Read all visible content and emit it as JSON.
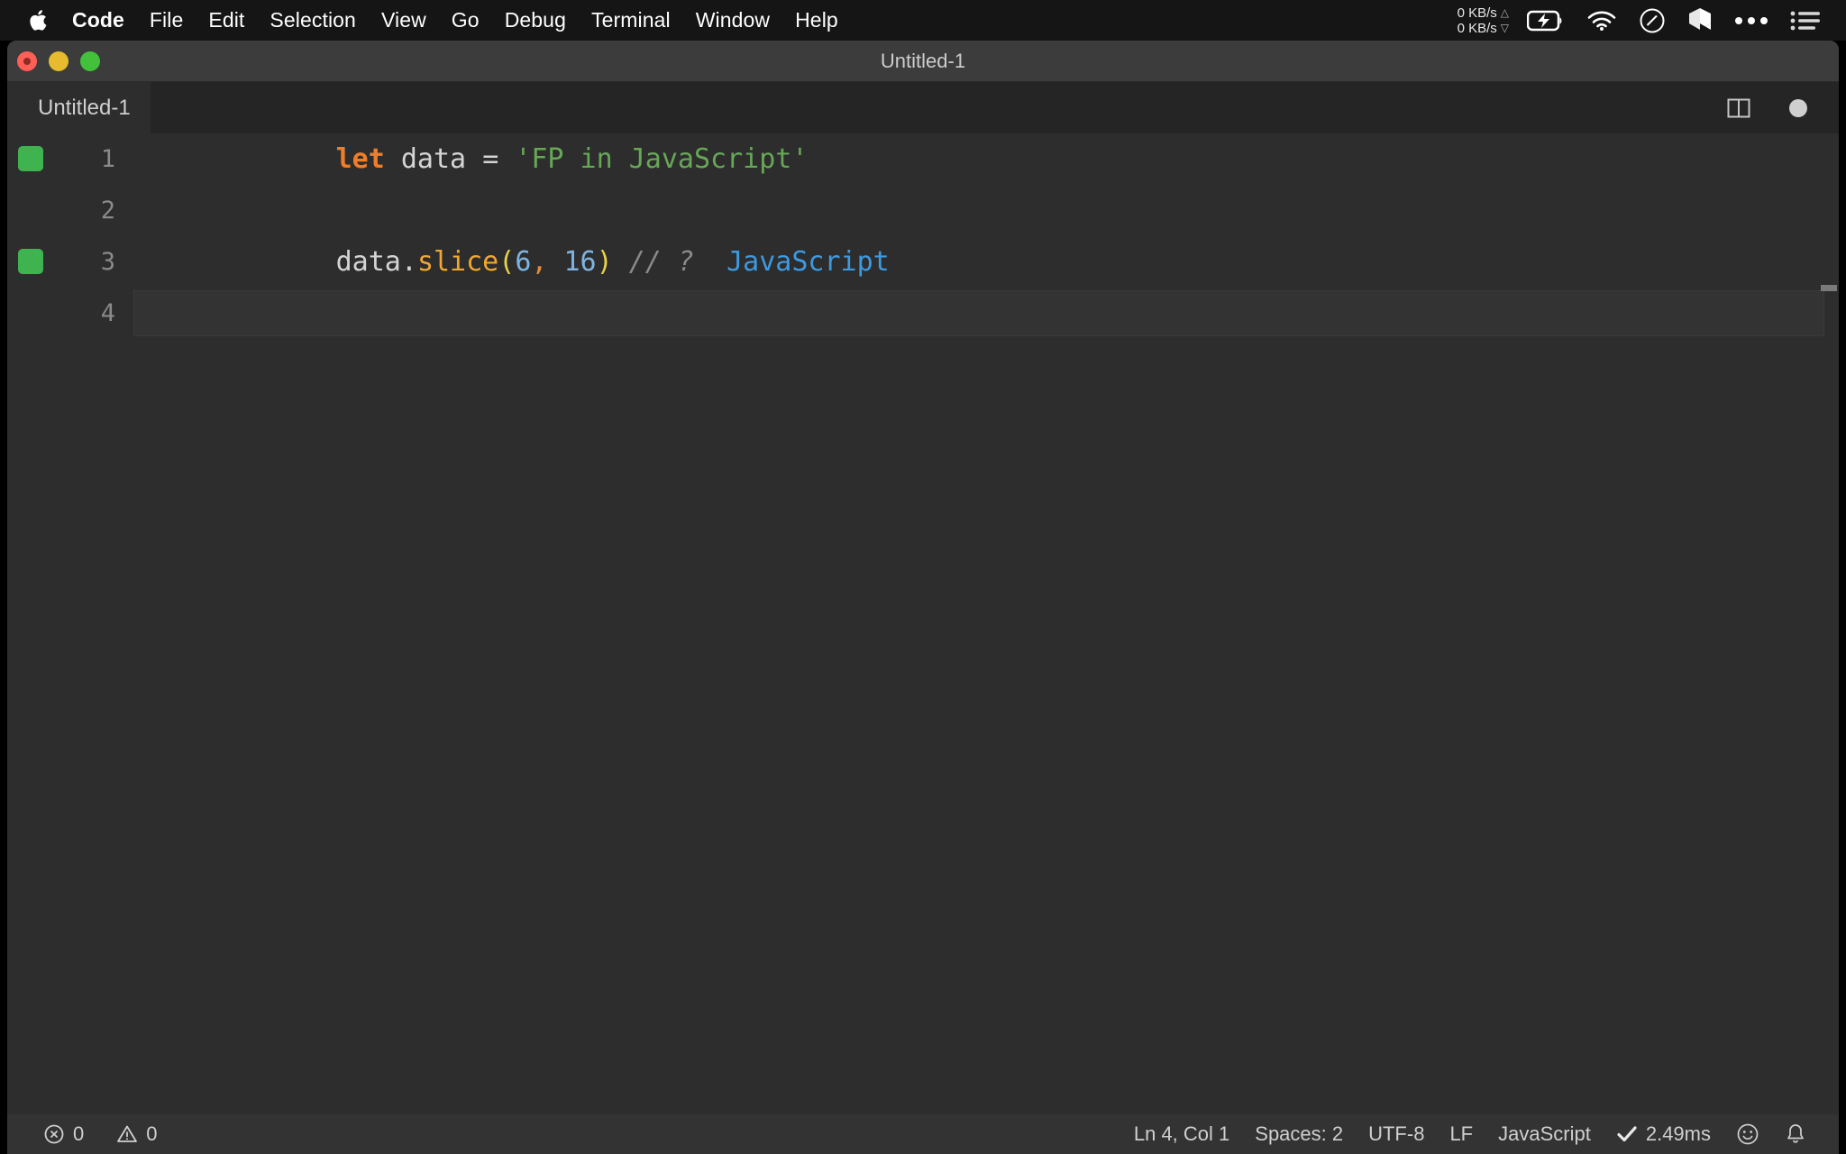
{
  "menubar": {
    "apple_icon": "apple-logo-icon",
    "items": [
      {
        "label": "Code",
        "bold": true
      },
      {
        "label": "File"
      },
      {
        "label": "Edit"
      },
      {
        "label": "Selection"
      },
      {
        "label": "View"
      },
      {
        "label": "Go"
      },
      {
        "label": "Debug"
      },
      {
        "label": "Terminal"
      },
      {
        "label": "Window"
      },
      {
        "label": "Help"
      }
    ],
    "tray": {
      "network_up": "0 KB/s",
      "network_down": "0 KB/s",
      "up_arrow": "△",
      "down_arrow": "▽",
      "icons": [
        "battery-charging-icon",
        "wifi-icon",
        "do-not-disturb-icon",
        "dropbox-cube-icon",
        "control-center-ellipsis-icon",
        "list-menu-icon"
      ]
    }
  },
  "window": {
    "title": "Untitled-1",
    "traffic_lights": [
      "close-red",
      "minimize-yellow",
      "maximize-green"
    ],
    "has_unsaved_changes": true
  },
  "tabbar": {
    "tabs": [
      {
        "label": "Untitled-1",
        "active": true,
        "dirty": true
      }
    ],
    "actions": [
      "split-editor-icon",
      "unsaved-dot-icon"
    ]
  },
  "editor": {
    "language": "JavaScript",
    "lines": [
      {
        "number": "1",
        "coverage": true,
        "active": false,
        "tokens": [
          {
            "text": "let",
            "cls": "t-kw"
          },
          {
            "text": " ",
            "cls": "t-plain"
          },
          {
            "text": "data",
            "cls": "t-plain"
          },
          {
            "text": " ",
            "cls": "t-plain"
          },
          {
            "text": "=",
            "cls": "t-plain"
          },
          {
            "text": " ",
            "cls": "t-plain"
          },
          {
            "text": "'FP in JavaScript'",
            "cls": "t-str"
          }
        ]
      },
      {
        "number": "2",
        "coverage": false,
        "active": false,
        "tokens": []
      },
      {
        "number": "3",
        "coverage": true,
        "active": false,
        "tokens": [
          {
            "text": "data",
            "cls": "t-plain"
          },
          {
            "text": ".",
            "cls": "t-plain"
          },
          {
            "text": "slice",
            "cls": "t-fn"
          },
          {
            "text": "(",
            "cls": "t-paren"
          },
          {
            "text": "6",
            "cls": "t-num"
          },
          {
            "text": ",",
            "cls": "t-comma"
          },
          {
            "text": " ",
            "cls": "t-plain"
          },
          {
            "text": "16",
            "cls": "t-num"
          },
          {
            "text": ")",
            "cls": "t-paren"
          },
          {
            "text": " ",
            "cls": "t-plain"
          },
          {
            "text": "// ?",
            "cls": "t-comment"
          },
          {
            "text": "  ",
            "cls": "t-plain"
          },
          {
            "text": "JavaScript",
            "cls": "t-result"
          }
        ]
      },
      {
        "number": "4",
        "coverage": false,
        "active": true,
        "tokens": []
      }
    ]
  },
  "statusbar": {
    "left": [
      {
        "icon": "error-icon",
        "label": "0",
        "name": "error-count"
      },
      {
        "icon": "warning-icon",
        "label": "0",
        "name": "warning-count"
      }
    ],
    "right": [
      {
        "label": "Ln 4, Col 1",
        "name": "cursor-position"
      },
      {
        "label": "Spaces: 2",
        "name": "indentation"
      },
      {
        "label": "UTF-8",
        "name": "encoding"
      },
      {
        "label": "LF",
        "name": "eol"
      },
      {
        "label": "JavaScript",
        "name": "language-mode"
      },
      {
        "icon": "check-icon",
        "label": "2.49ms",
        "name": "quokka-timing"
      }
    ],
    "right_icons": [
      "feedback-smiley-icon",
      "notifications-bell-icon"
    ]
  },
  "colors": {
    "editor_background": "#2d2d2d",
    "tabbar_background": "#252526",
    "statusbar_background": "#333333",
    "titlebar_background": "#3c3c3c",
    "coverage_green": "#3fb34f",
    "keyword_orange": "#f07d28",
    "string_green": "#67a757",
    "result_blue": "#3d9ae0"
  }
}
